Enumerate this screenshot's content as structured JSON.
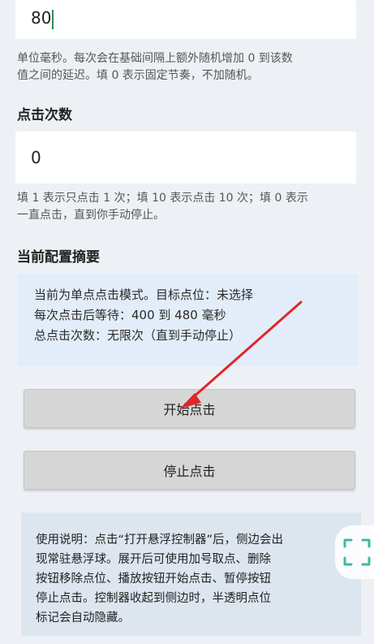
{
  "interval_input": {
    "value": "80"
  },
  "interval_hint": [
    "单位毫秒。每次会在基础间隔上额外随机增加 0 到该数",
    "值之间的延迟。填 0 表示固定节奏，不加随机。"
  ],
  "click_count_heading": "点击次数",
  "click_count_input": {
    "value": "0"
  },
  "click_count_hint": [
    "填 1 表示只点击 1 次；填 10 表示点击 10 次；填 0 表示",
    "一直点击，直到你手动停止。"
  ],
  "summary_heading": "当前配置摘要",
  "summary": {
    "line1": "当前为单点点击模式。目标点位：未选择",
    "line2": "每次点击后等待：400 到 480 毫秒",
    "line3": "总点击次数：无限次（直到手动停止）"
  },
  "buttons": {
    "start": "开始点击",
    "stop": "停止点击"
  },
  "info": [
    "使用说明：点击“打开悬浮控制器”后，侧边会出",
    "现常驻悬浮球。展开后可使用加号取点、删除",
    "按钮移除点位、播放按钮开始点击、暂停按钮",
    "停止点击。控制器收起到侧边时，半透明点位",
    "标记会自动隐藏。"
  ],
  "annotation": {
    "color": "#e0262a"
  },
  "float_ball": {
    "icon": "expand-arrows-icon",
    "color": "#3fb8a6"
  }
}
